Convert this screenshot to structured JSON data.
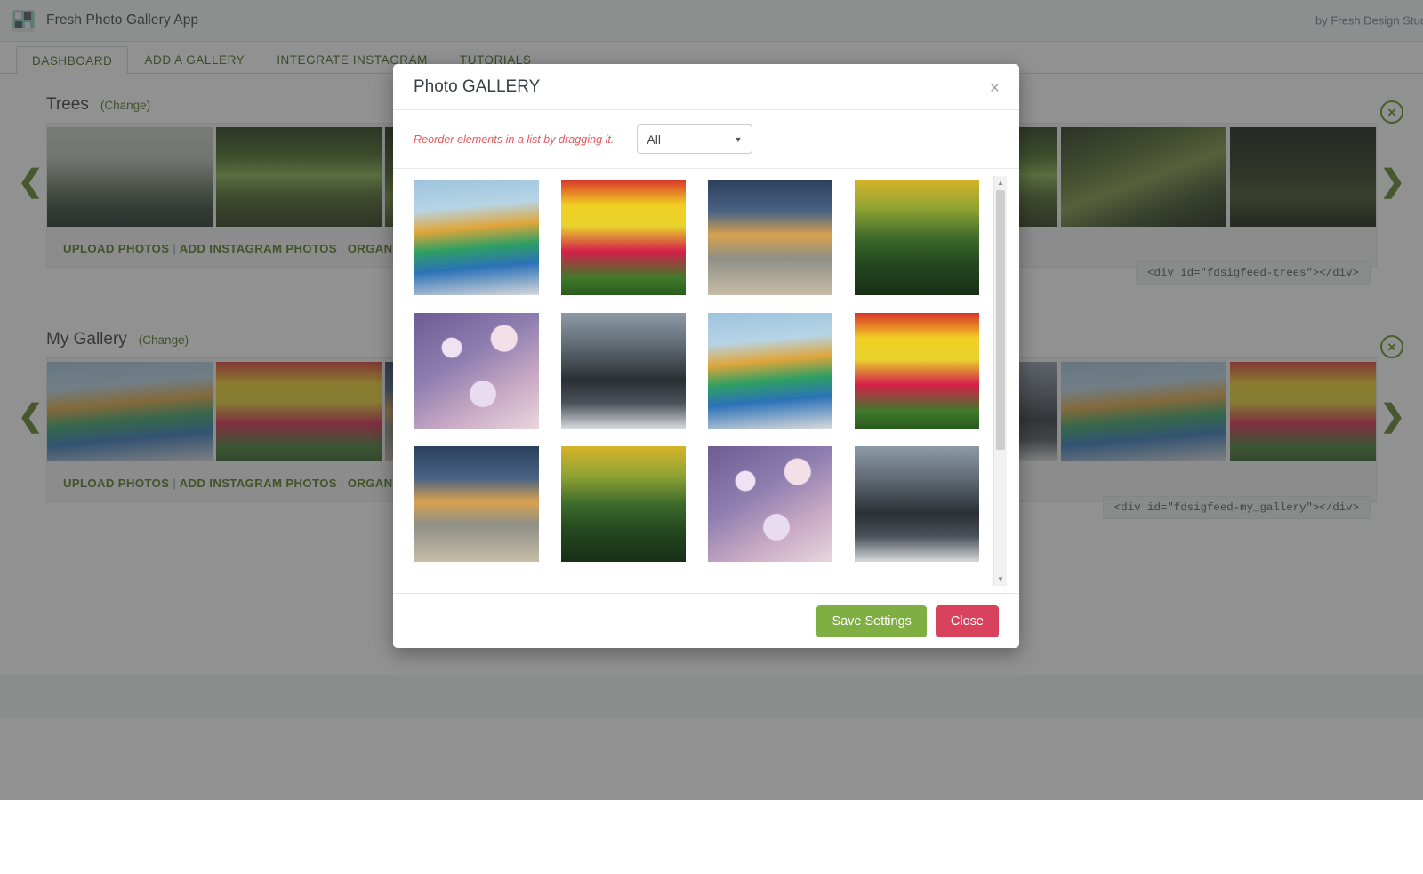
{
  "app": {
    "brand_title": "Fresh Photo Gallery App",
    "byline": "by Fresh Design Stud",
    "logo_icon": "app-logo-icon"
  },
  "tabs": [
    {
      "label": "DASHBOARD",
      "active": true
    },
    {
      "label": "ADD A GALLERY",
      "active": false
    },
    {
      "label": "INTEGRATE INSTAGRAM",
      "active": false
    },
    {
      "label": "TUTORIALS",
      "active": false
    }
  ],
  "galleries": [
    {
      "title": "Trees",
      "change_label": "(Change)",
      "actions": [
        "UPLOAD PHOTOS",
        "ADD INSTAGRAM PHOTOS",
        "ORGANIZE"
      ],
      "separator": "|",
      "shortcode": "<div id=\"fdsigfeed-trees\"></div>",
      "prev_icon": "chevron-left-icon",
      "next_icon": "chevron-right-icon",
      "remove_icon": "close-circle-icon",
      "thumbs": [
        "ph-fog",
        "ph-path",
        "ph-canopy",
        "ph-oak",
        "ph-path",
        "ph-canopy",
        "ph-oak",
        "ph-dark"
      ]
    },
    {
      "title": "My Gallery",
      "change_label": "(Change)",
      "actions": [
        "UPLOAD PHOTOS",
        "ADD INSTAGRAM PHOTOS",
        "ORGANIZE"
      ],
      "separator": "|",
      "shortcode": "<div id=\"fdsigfeed-my_gallery\"></div>",
      "prev_icon": "chevron-left-icon",
      "next_icon": "chevron-right-icon",
      "remove_icon": "close-circle-icon",
      "thumbs": [
        "ph-umb",
        "ph-tulip",
        "ph-beach",
        "ph-falls",
        "ph-bokeh",
        "ph-mtn",
        "ph-umb",
        "ph-tulip"
      ]
    }
  ],
  "modal": {
    "title": "Photo GALLERY",
    "close_icon": "close-icon",
    "hint": "Reorder elements in a list by dragging it.",
    "filter": {
      "value": "All",
      "caret_icon": "chevron-down-icon",
      "options": [
        "All"
      ]
    },
    "scrollbar": {
      "up_icon": "scroll-up-arrow-icon",
      "down_icon": "scroll-down-arrow-icon"
    },
    "photos": [
      "ph-umb",
      "ph-tulip",
      "ph-beach",
      "ph-falls",
      "ph-bokeh",
      "ph-mtn",
      "ph-umb",
      "ph-tulip",
      "ph-beach",
      "ph-falls",
      "ph-bokeh",
      "ph-mtn"
    ],
    "save_label": "Save Settings",
    "close_label": "Close"
  },
  "colors": {
    "accent_green": "#4d7314",
    "button_green": "#7fae42",
    "button_red": "#d9425c",
    "hint_red": "#e8595f",
    "overlay": "rgba(59,59,59,0.56)"
  }
}
